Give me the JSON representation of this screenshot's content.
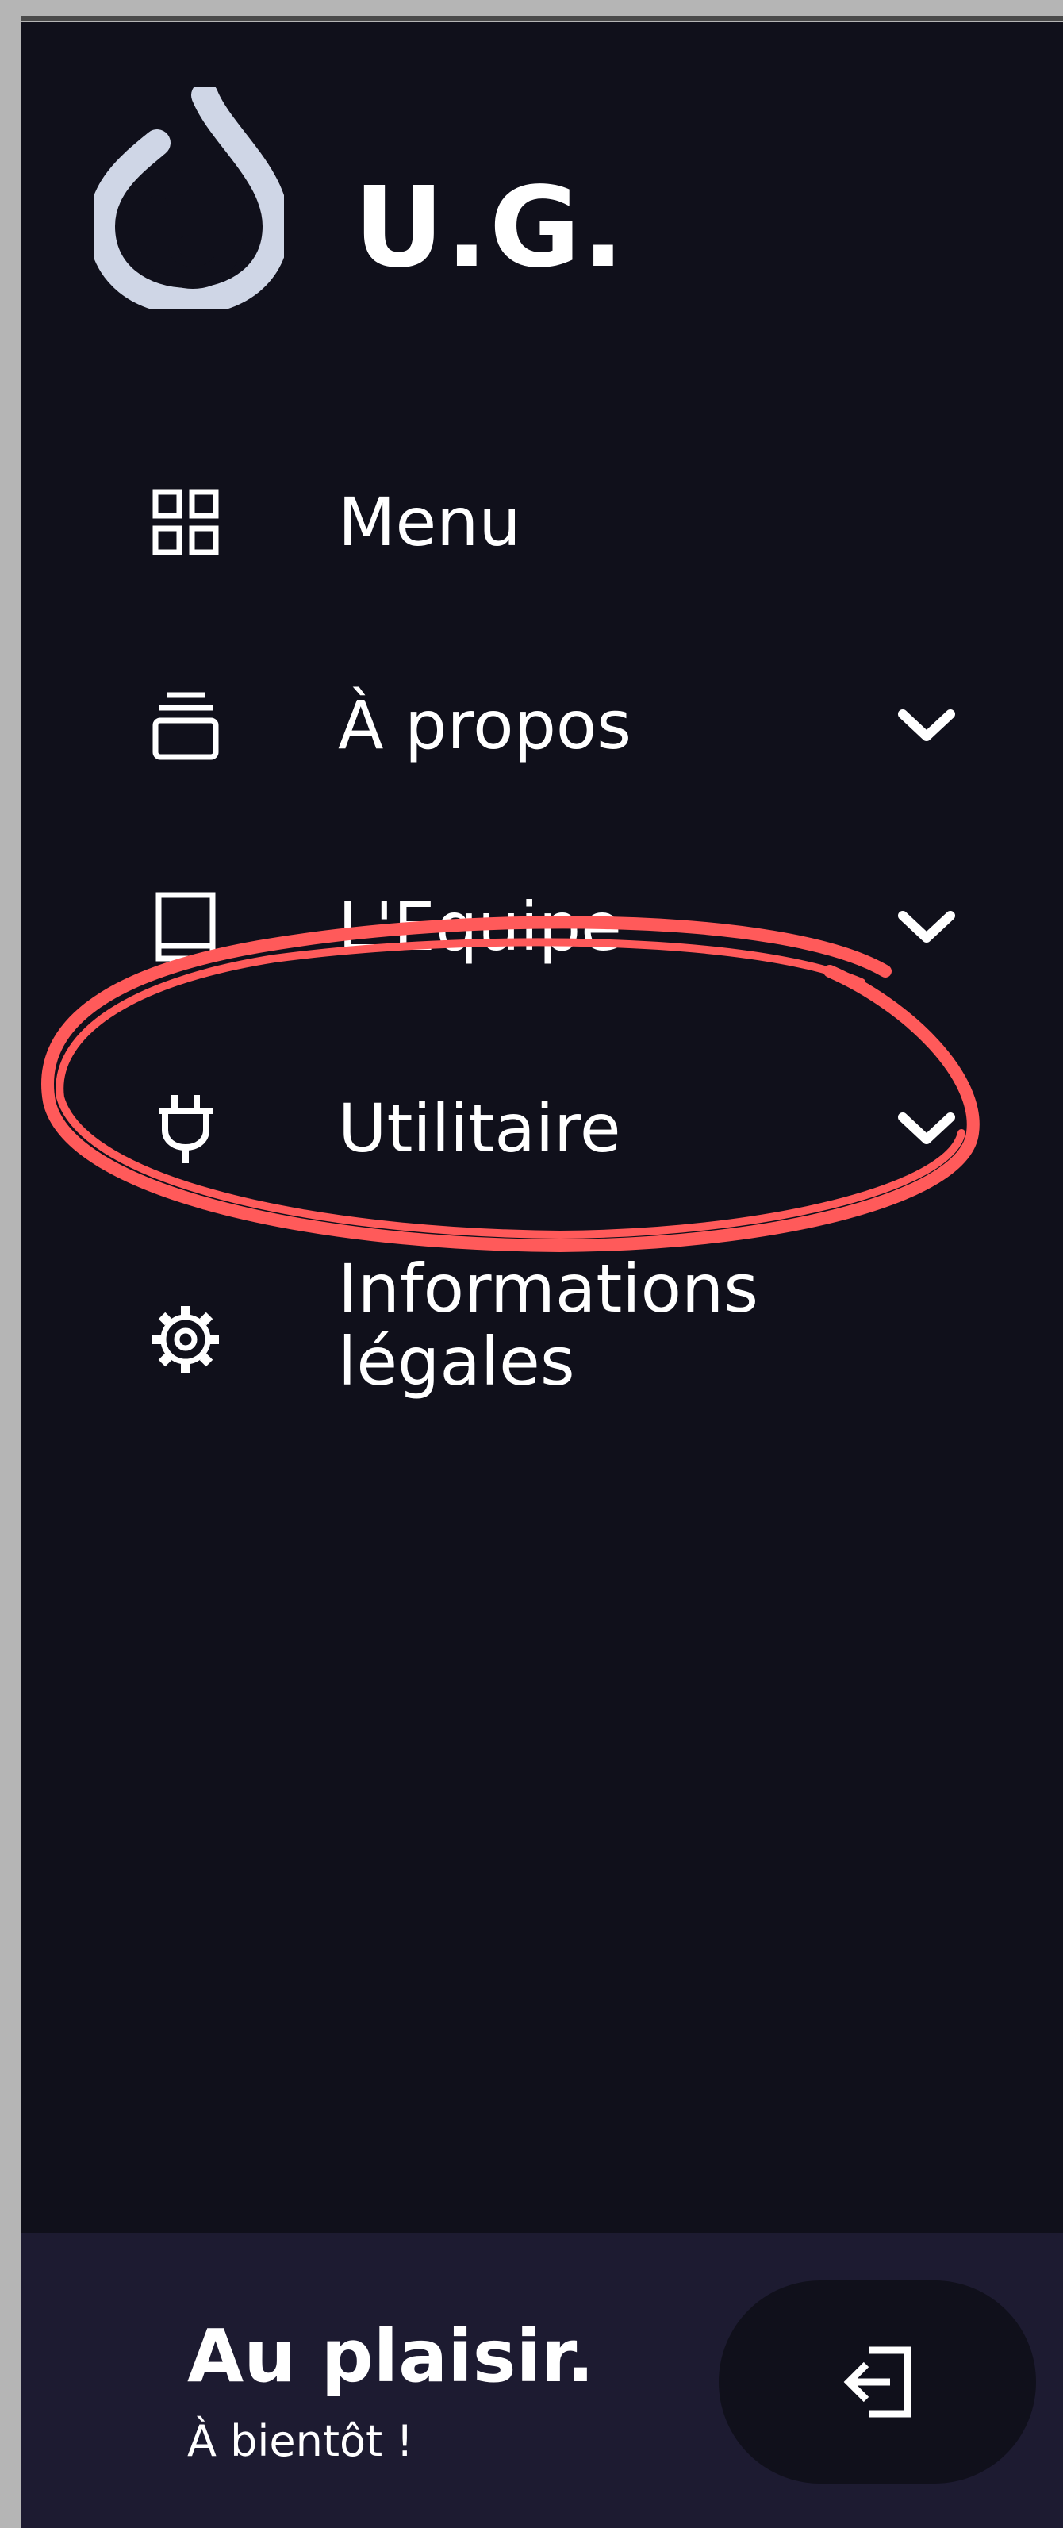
{
  "brand": {
    "title": "U.G.",
    "logo_icon": "water-drop-logo-icon"
  },
  "nav": {
    "items": [
      {
        "label": "Menu",
        "icon": "grid-icon",
        "has_chevron": false
      },
      {
        "label": "À propos",
        "icon": "stack-icon",
        "has_chevron": true
      },
      {
        "label": "L'Equipe",
        "icon": "book-icon",
        "has_chevron": true
      },
      {
        "label": "Utilitaire",
        "icon": "plug-icon",
        "has_chevron": true,
        "highlighted": true
      },
      {
        "label": "Informations légales",
        "icon": "gear-icon",
        "has_chevron": false
      }
    ]
  },
  "footer": {
    "greeting": "Au plaisir.",
    "subtitle": "À bientôt !",
    "logout_icon": "logout-icon"
  },
  "colors": {
    "sidebar_bg": "#10101b",
    "footer_bg": "#1d1b31",
    "text": "#ffffff",
    "annotation": "#ff5a5a"
  }
}
